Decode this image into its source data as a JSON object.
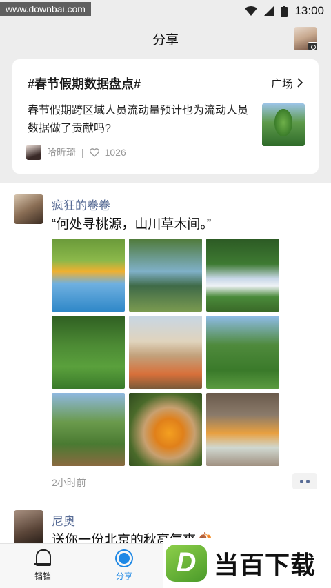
{
  "watermark": "www.downbai.com",
  "status": {
    "time": "13:00"
  },
  "header": {
    "title": "分享"
  },
  "topic": {
    "title": "#春节假期数据盘点#",
    "link": "广场",
    "text": "春节假期跨区域人员流动量预计也为流动人员数据做了贡献吗?",
    "author": "哈昕琦",
    "likes": "1026"
  },
  "post1": {
    "author": "疯狂的卷卷",
    "text": "“何处寻桃源，山川草木间。”",
    "time": "2小时前",
    "images": [
      "orange-tree-sea",
      "garden-pond",
      "arch-window",
      "green-tree",
      "old-truck-flowers",
      "banana-garden",
      "picnic-basket",
      "orange-basket",
      "dining-table"
    ]
  },
  "post2": {
    "author": "尼奥",
    "text": "送你一份北京的秋高气爽🍂"
  },
  "tabbar": {
    "tab1": "铛铛",
    "tab2": "分享"
  },
  "brand": {
    "logo": "D",
    "text": "当百下载"
  },
  "colors": {
    "accent": "#1e88e5",
    "link": "#576b95"
  }
}
